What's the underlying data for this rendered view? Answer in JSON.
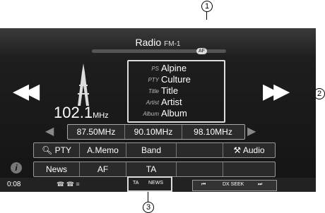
{
  "title": {
    "label": "Radio",
    "band": "FM-1",
    "af_badge": "AF"
  },
  "callouts": {
    "one": "1",
    "two": "2",
    "three": "3"
  },
  "station": {
    "frequency": "102.1",
    "unit": "MHz"
  },
  "info": [
    {
      "key": "PS",
      "value": "Alpine"
    },
    {
      "key": "PTY",
      "value": "Culture"
    },
    {
      "key": "Title",
      "value": "Title"
    },
    {
      "key": "Artist",
      "value": "Artist"
    },
    {
      "key": "Album",
      "value": "Album"
    }
  ],
  "presets": [
    "87.50MHz",
    "90.10MHz",
    "98.10MHz"
  ],
  "row1": {
    "pty": "PTY",
    "amemo": "A.Memo",
    "band": "Band",
    "audio": "Audio"
  },
  "row2": {
    "news": "News",
    "af": "AF",
    "ta": "TA"
  },
  "status": {
    "time": "0:08",
    "ta": "TA",
    "news": "NEWS",
    "dx_seek": "DX SEEK"
  }
}
